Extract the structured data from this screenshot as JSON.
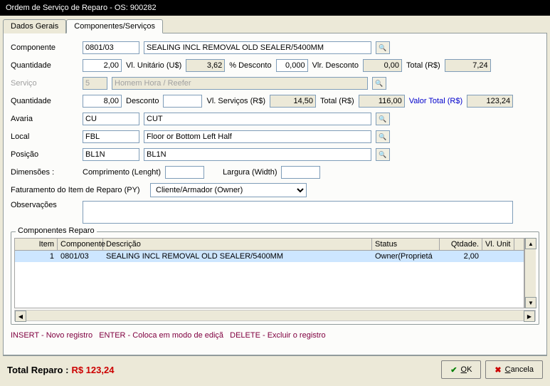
{
  "window": {
    "title": "Ordem de Serviço de Reparo - OS: 900282"
  },
  "tabs": {
    "general": "Dados Gerais",
    "components": "Componentes/Serviços"
  },
  "labels": {
    "componente": "Componente",
    "quantidade": "Quantidade",
    "vl_unitario": "Vl. Unitário (U$)",
    "pct_desconto": "% Desconto",
    "vlr_desconto": "Vlr. Desconto",
    "total_rs": "Total (R$)",
    "servico": "Serviço",
    "desconto": "Desconto",
    "vl_servicos": "Vl. Serviços (R$)",
    "valor_total_rs": "Valor Total (R$)",
    "avaria": "Avaria",
    "local": "Local",
    "posicao": "Posição",
    "dimensoes": "Dimensões :",
    "comprimento": "Comprimento (Lenght)",
    "largura": "Largura (Width)",
    "faturamento": "Faturamento do Item de Reparo (PY)",
    "observacoes": "Observações",
    "componentes_reparo": "Componentes Reparo"
  },
  "fields": {
    "componente_code": "0801/03",
    "componente_desc": "SEALING INCL REMOVAL OLD SEALER/5400MM",
    "quantidade1": "2,00",
    "vl_unitario": "3,62",
    "pct_desconto": "0,000",
    "vlr_desconto": "0,00",
    "total_rs1": "7,24",
    "servico_code": "5",
    "servico_desc": "Homem Hora / Reefer",
    "quantidade2": "8,00",
    "desconto2": "",
    "vl_servicos": "14,50",
    "total_rs2": "116,00",
    "valor_total": "123,24",
    "avaria_code": "CU",
    "avaria_desc": "CUT",
    "local_code": "FBL",
    "local_desc": "Floor or Bottom Left Half",
    "posicao_code": "BL1N",
    "posicao_desc": "BL1N",
    "comprimento": "",
    "largura": "",
    "faturamento_value": "Cliente/Armador (Owner)",
    "observacoes": ""
  },
  "grid": {
    "headers": {
      "item": "Item",
      "componente": "Componente",
      "descricao": "Descrição",
      "status": "Status",
      "qtdade": "Qtdade.",
      "vl_unit": "Vl. Unit"
    },
    "rows": [
      {
        "item": "1",
        "componente": "0801/03",
        "descricao": "SEALING INCL REMOVAL OLD SEALER/5400MM",
        "status": "Owner(Proprietá",
        "qtdade": "2,00",
        "vl_unit": ""
      }
    ]
  },
  "hints": {
    "insert": "INSERT - Novo registro",
    "enter": "ENTER - Coloca em modo de ediçã",
    "delete": "DELETE - Excluir o registro"
  },
  "footer": {
    "total_label": "Total Reparo :",
    "total_value": "R$ 123,24",
    "ok": "OK",
    "cancel": "Cancela"
  }
}
